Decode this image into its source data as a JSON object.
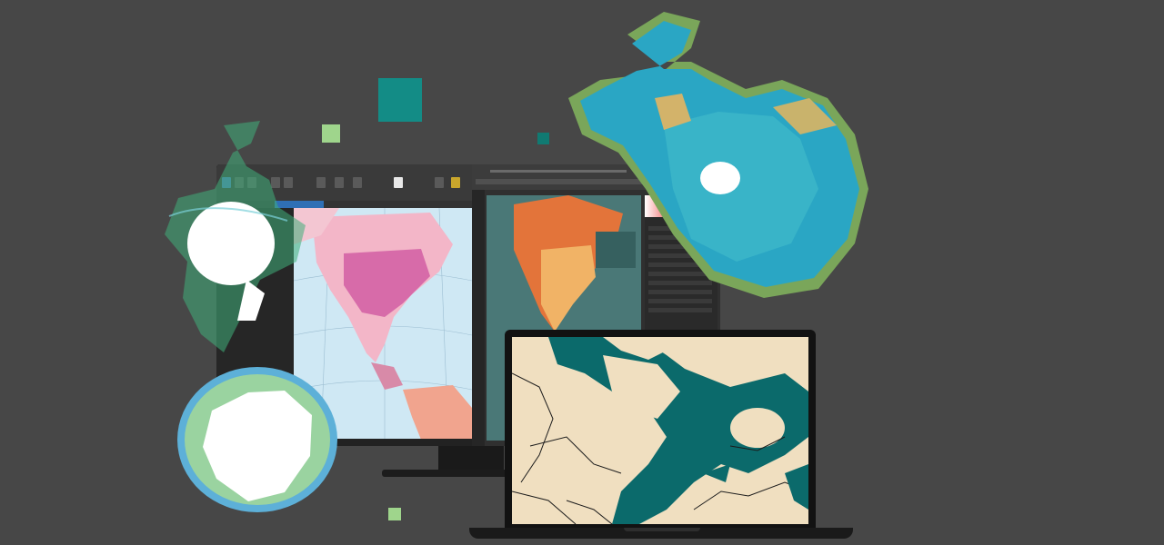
{
  "scene": {
    "background": "#474747",
    "accent_colors": {
      "teal_dark": "#138c86",
      "teal_small": "#107a72",
      "light_green": "#9fd58c",
      "laptop_water": "#0b6a6b",
      "laptop_land": "#f0dfc0",
      "world_map_ocean": "#2aa6c4",
      "world_map_land": "#79a35a",
      "antarctica_ice": "#ffffff"
    },
    "icons": [
      "teal-square-icon",
      "green-square-icon",
      "monitor-icon",
      "laptop-icon",
      "world-map-icon",
      "antarctica-map-icon",
      "arctic-map-icon"
    ]
  }
}
